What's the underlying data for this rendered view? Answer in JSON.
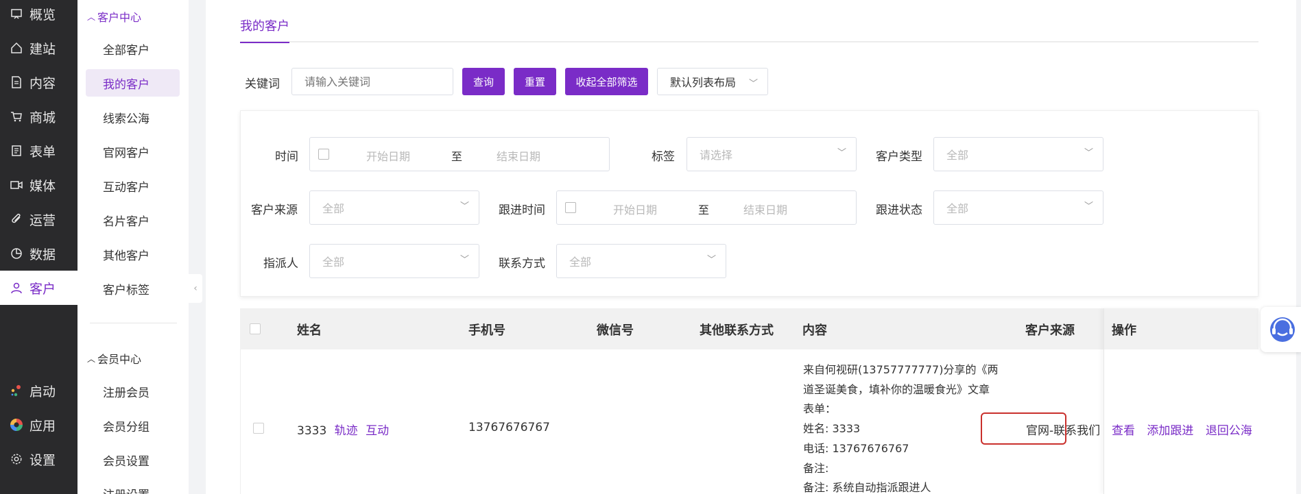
{
  "colors": {
    "accent": "#7a2cc7",
    "nav_bg": "#2a2a2c",
    "highlight": "#c9302c"
  },
  "nav": {
    "items": [
      {
        "label": "概览",
        "icon": "overview-icon"
      },
      {
        "label": "建站",
        "icon": "home-icon"
      },
      {
        "label": "内容",
        "icon": "document-icon"
      },
      {
        "label": "商城",
        "icon": "cart-icon"
      },
      {
        "label": "表单",
        "icon": "form-icon"
      },
      {
        "label": "媒体",
        "icon": "video-icon"
      },
      {
        "label": "运营",
        "icon": "clip-icon"
      },
      {
        "label": "数据",
        "icon": "pie-chart-icon"
      },
      {
        "label": "客户",
        "icon": "user-icon"
      }
    ],
    "bottom": [
      {
        "label": "启动",
        "icon": "launch-icon"
      },
      {
        "label": "应用",
        "icon": "apps-icon"
      },
      {
        "label": "设置",
        "icon": "gear-icon"
      }
    ]
  },
  "subnav": {
    "group1": "客户中心",
    "group1_items": [
      "全部客户",
      "我的客户",
      "线索公海",
      "官网客户",
      "互动客户",
      "名片客户",
      "其他客户",
      "客户标签"
    ],
    "group2": "会员中心",
    "group2_items": [
      "注册会员",
      "会员分组",
      "会员设置",
      "注册设置"
    ]
  },
  "tab": "我的客户",
  "toolbar": {
    "keyword_label": "关键词",
    "keyword_placeholder": "请输入关键词",
    "search": "查询",
    "reset": "重置",
    "collapse": "收起全部筛选",
    "layout": "默认列表布局"
  },
  "filters": {
    "time_label": "时间",
    "start_placeholder": "开始日期",
    "range_sep": "至",
    "end_placeholder": "结束日期",
    "tag_label": "标签",
    "tag_placeholder": "请选择",
    "type_label": "客户类型",
    "all": "全部",
    "source_label": "客户来源",
    "follow_time_label": "跟进时间",
    "follow_status_label": "跟进状态",
    "assignee_label": "指派人",
    "contact_label": "联系方式"
  },
  "table": {
    "headers": [
      "姓名",
      "手机号",
      "微信号",
      "其他联系方式",
      "内容",
      "客户来源",
      "操作"
    ],
    "row": {
      "name": "3333",
      "track": "轨迹",
      "interact": "互动",
      "phone": "13767676767",
      "content": [
        "来自何视研(13757777777)分享的《两",
        "道圣诞美食，填补你的温暖食光》文章",
        "表单：",
        "姓名: 3333",
        "电话: 13767676767",
        "备注:",
        "备注: 系统自动指派跟进人"
      ],
      "source": "官网-联系我们",
      "actions": [
        "查看",
        "添加跟进",
        "退回公海"
      ]
    }
  }
}
